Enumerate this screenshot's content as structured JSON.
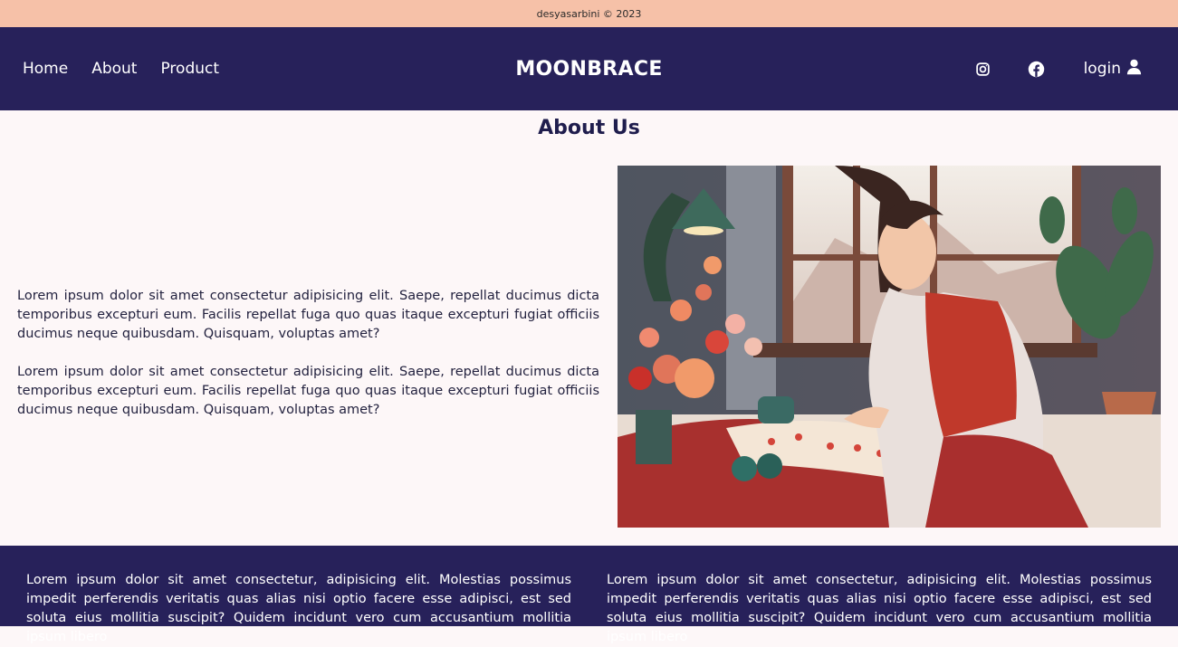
{
  "topbar": {
    "copyright": "desyasarbini © 2023"
  },
  "nav": {
    "links": [
      {
        "label": "Home"
      },
      {
        "label": "About"
      },
      {
        "label": "Product"
      }
    ],
    "brand": "MOONBRACE",
    "login_label": "login",
    "icons": [
      "instagram-icon",
      "facebook-icon",
      "user-icon"
    ]
  },
  "about": {
    "title": "About Us",
    "paragraphs": [
      "Lorem ipsum dolor sit amet consectetur adipisicing elit. Saepe, repellat ducimus dicta temporibus excepturi eum. Facilis repellat fuga quo quas itaque excepturi fugiat officiis ducimus neque quibusdam. Quisquam, voluptas amet?",
      "Lorem ipsum dolor sit amet consectetur adipisicing elit. Saepe, repellat ducimus dicta temporibus excepturi eum. Facilis repellat fuga quo quas itaque excepturi fugiat officiis ducimus neque quibusdam. Quisquam, voluptas amet?"
    ]
  },
  "footer": {
    "columns": [
      "Lorem ipsum dolor sit amet consectetur, adipisicing elit. Molestias possimus impedit perferendis veritatis quas alias nisi optio facere esse adipisci, est sed soluta eius mollitia suscipit? Quidem incidunt vero cum accusantium mollitia ipsum libero",
      "Lorem ipsum dolor sit amet consectetur, adipisicing elit. Molestias possimus impedit perferendis veritatis quas alias nisi optio facere esse adipisci, est sed soluta eius mollitia suscipit? Quidem incidunt vero cum accusantium mollitia ipsum libero"
    ]
  },
  "colors": {
    "topbar": "#f6c1a8",
    "navbar": "#27215a",
    "page_bg": "#fdf7f8",
    "title": "#1f1d4d"
  }
}
